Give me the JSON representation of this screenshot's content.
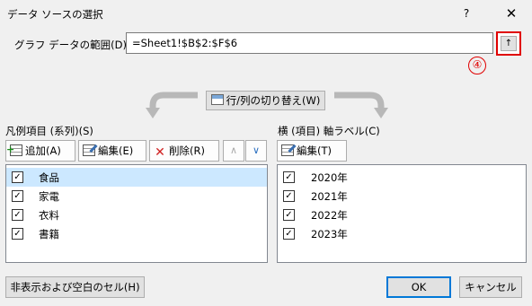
{
  "window": {
    "title": "データ ソースの選択",
    "help": "?",
    "close": "✕"
  },
  "range": {
    "label": "グラフ データの範囲(D):",
    "value": "=Sheet1!$B$2:$F$6",
    "collapse_glyph": "↑",
    "step_marker": "④"
  },
  "switch_button": "行/列の切り替え(W)",
  "series": {
    "label": "凡例項目 (系列)(S)",
    "add": "追加(A)",
    "edit": "編集(E)",
    "delete": "削除(R)",
    "up": "∧",
    "down": "∨",
    "items": [
      {
        "label": "食品",
        "checked": true,
        "selected": true
      },
      {
        "label": "家電",
        "checked": true,
        "selected": false
      },
      {
        "label": "衣料",
        "checked": true,
        "selected": false
      },
      {
        "label": "書籍",
        "checked": true,
        "selected": false
      }
    ]
  },
  "categories": {
    "label": "横 (項目) 軸ラベル(C)",
    "edit": "編集(T)",
    "items": [
      {
        "label": "2020年",
        "checked": true
      },
      {
        "label": "2021年",
        "checked": true
      },
      {
        "label": "2022年",
        "checked": true
      },
      {
        "label": "2023年",
        "checked": true
      }
    ]
  },
  "footer": {
    "hidden_cells": "非表示および空白のセル(H)",
    "ok": "OK",
    "cancel": "キャンセル"
  },
  "colors": {
    "highlight": "#e00000",
    "selection": "#cce8ff",
    "default_button_border": "#0078d7"
  }
}
